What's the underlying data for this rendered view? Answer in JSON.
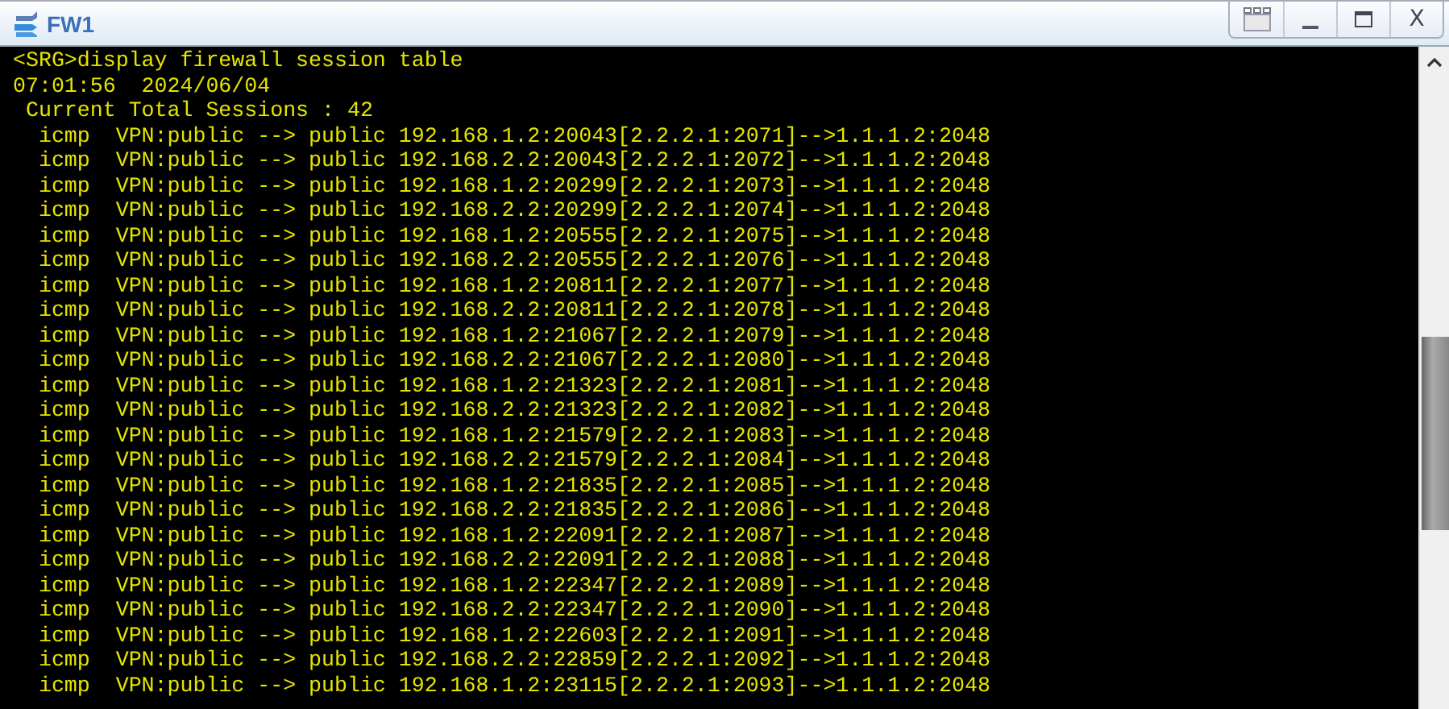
{
  "window": {
    "title": "FW1",
    "close_label": "X"
  },
  "terminal": {
    "lines": [
      "<SRG>display firewall session table",
      "07:01:56  2024/06/04",
      " Current Total Sessions : 42",
      "  icmp  VPN:public --> public 192.168.1.2:20043[2.2.2.1:2071]-->1.1.1.2:2048",
      "  icmp  VPN:public --> public 192.168.2.2:20043[2.2.2.1:2072]-->1.1.1.2:2048",
      "  icmp  VPN:public --> public 192.168.1.2:20299[2.2.2.1:2073]-->1.1.1.2:2048",
      "  icmp  VPN:public --> public 192.168.2.2:20299[2.2.2.1:2074]-->1.1.1.2:2048",
      "  icmp  VPN:public --> public 192.168.1.2:20555[2.2.2.1:2075]-->1.1.1.2:2048",
      "  icmp  VPN:public --> public 192.168.2.2:20555[2.2.2.1:2076]-->1.1.1.2:2048",
      "  icmp  VPN:public --> public 192.168.1.2:20811[2.2.2.1:2077]-->1.1.1.2:2048",
      "  icmp  VPN:public --> public 192.168.2.2:20811[2.2.2.1:2078]-->1.1.1.2:2048",
      "  icmp  VPN:public --> public 192.168.1.2:21067[2.2.2.1:2079]-->1.1.1.2:2048",
      "  icmp  VPN:public --> public 192.168.2.2:21067[2.2.2.1:2080]-->1.1.1.2:2048",
      "  icmp  VPN:public --> public 192.168.1.2:21323[2.2.2.1:2081]-->1.1.1.2:2048",
      "  icmp  VPN:public --> public 192.168.2.2:21323[2.2.2.1:2082]-->1.1.1.2:2048",
      "  icmp  VPN:public --> public 192.168.1.2:21579[2.2.2.1:2083]-->1.1.1.2:2048",
      "  icmp  VPN:public --> public 192.168.2.2:21579[2.2.2.1:2084]-->1.1.1.2:2048",
      "  icmp  VPN:public --> public 192.168.1.2:21835[2.2.2.1:2085]-->1.1.1.2:2048",
      "  icmp  VPN:public --> public 192.168.2.2:21835[2.2.2.1:2086]-->1.1.1.2:2048",
      "  icmp  VPN:public --> public 192.168.1.2:22091[2.2.2.1:2087]-->1.1.1.2:2048",
      "  icmp  VPN:public --> public 192.168.2.2:22091[2.2.2.1:2088]-->1.1.1.2:2048",
      "  icmp  VPN:public --> public 192.168.1.2:22347[2.2.2.1:2089]-->1.1.1.2:2048",
      "  icmp  VPN:public --> public 192.168.2.2:22347[2.2.2.1:2090]-->1.1.1.2:2048",
      "  icmp  VPN:public --> public 192.168.1.2:22603[2.2.2.1:2091]-->1.1.1.2:2048",
      "  icmp  VPN:public --> public 192.168.2.2:22859[2.2.2.1:2092]-->1.1.1.2:2048",
      "  icmp  VPN:public --> public 192.168.1.2:23115[2.2.2.1:2093]-->1.1.1.2:2048"
    ]
  }
}
